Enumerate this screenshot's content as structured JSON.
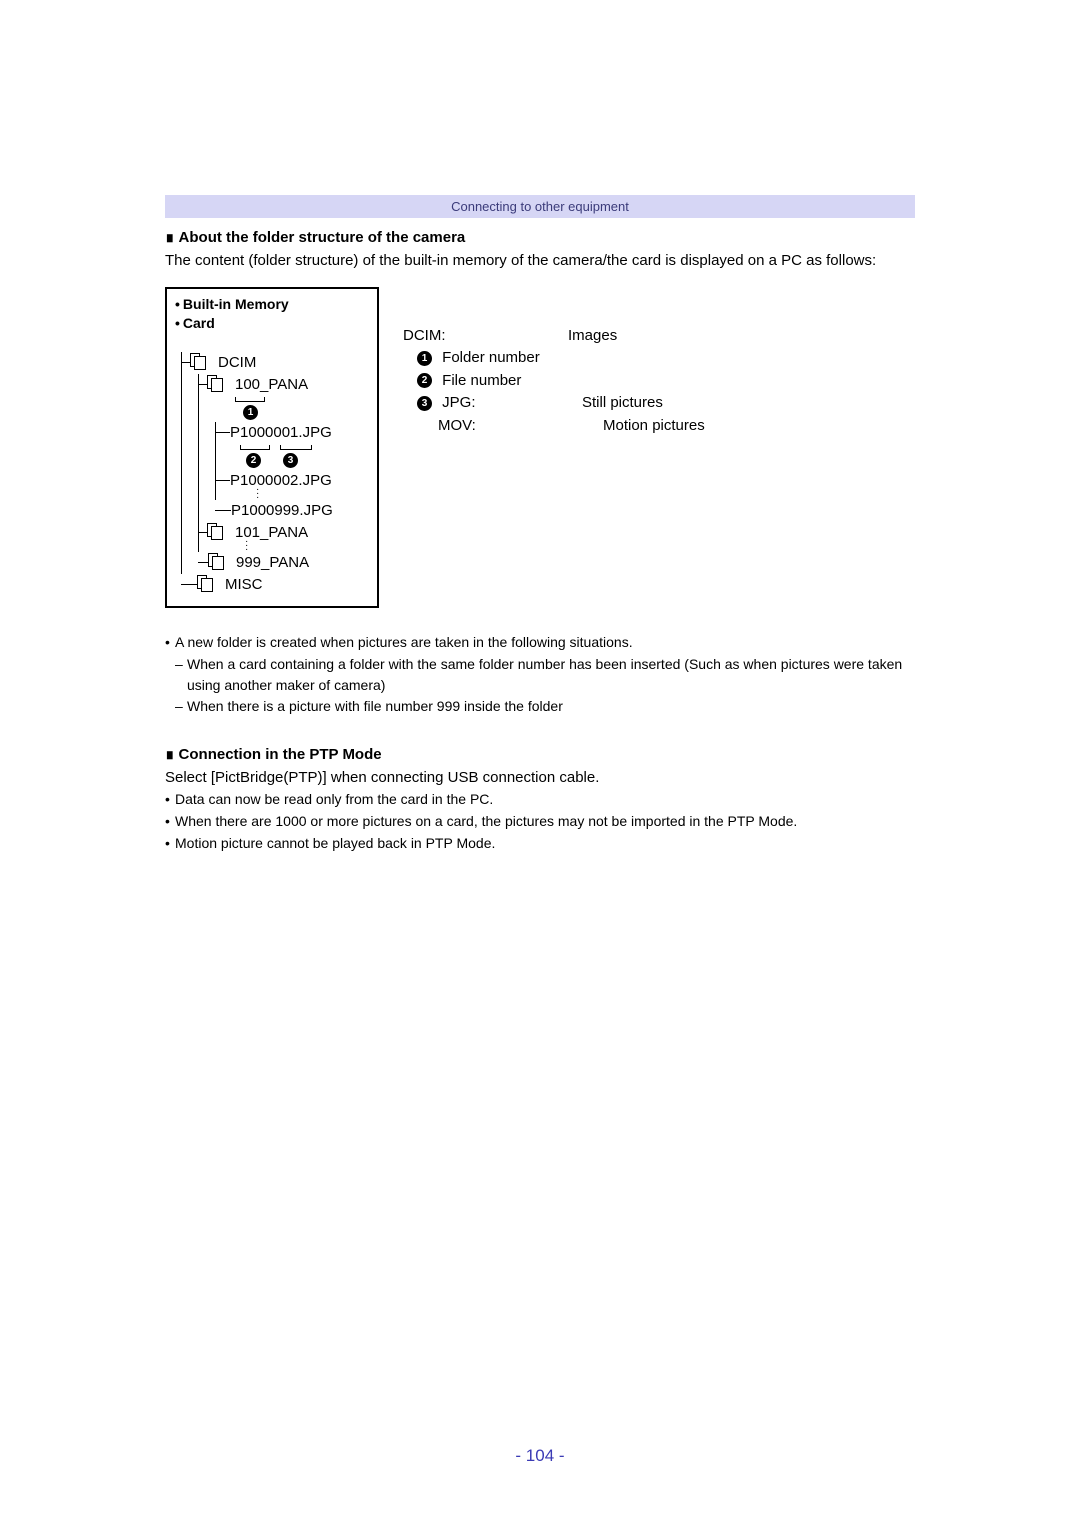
{
  "header": "Connecting to other equipment",
  "section1": {
    "title": "About the folder structure of the camera",
    "intro": "The content (folder structure) of the built-in memory of the camera/the card is displayed on a PC as follows:"
  },
  "diagram": {
    "memory1": "Built-in Memory",
    "memory2": "Card",
    "dcim": "DCIM",
    "folder100": "100_PANA",
    "file1": "P1000001.JPG",
    "file2": "P1000002.JPG",
    "file999": "P1000999.JPG",
    "folder101": "101_PANA",
    "folder999": "999_PANA",
    "misc": "MISC"
  },
  "legend": {
    "dcim_label": "DCIM:",
    "dcim_desc": "Images",
    "n1": "Folder number",
    "n2": "File number",
    "n3_label": "JPG:",
    "n3_desc": "Still pictures",
    "mov_label": "MOV:",
    "mov_desc": "Motion pictures"
  },
  "bullets1": {
    "b1": "A new folder is created when pictures are taken in the following situations.",
    "b1a": "When a card containing a folder with the same folder number has been inserted (Such as when pictures were taken using another maker of camera)",
    "b1b": "When there is a picture with file number 999 inside the folder"
  },
  "section2": {
    "title": "Connection in the PTP Mode",
    "intro": "Select [PictBridge(PTP)] when connecting USB connection cable.",
    "b1": "Data can now be read only from the card in the PC.",
    "b2": "When there are 1000 or more pictures on a card, the pictures may not be imported in the PTP Mode.",
    "b3": "Motion picture cannot be played back in PTP Mode."
  },
  "page_number": "- 104 -"
}
